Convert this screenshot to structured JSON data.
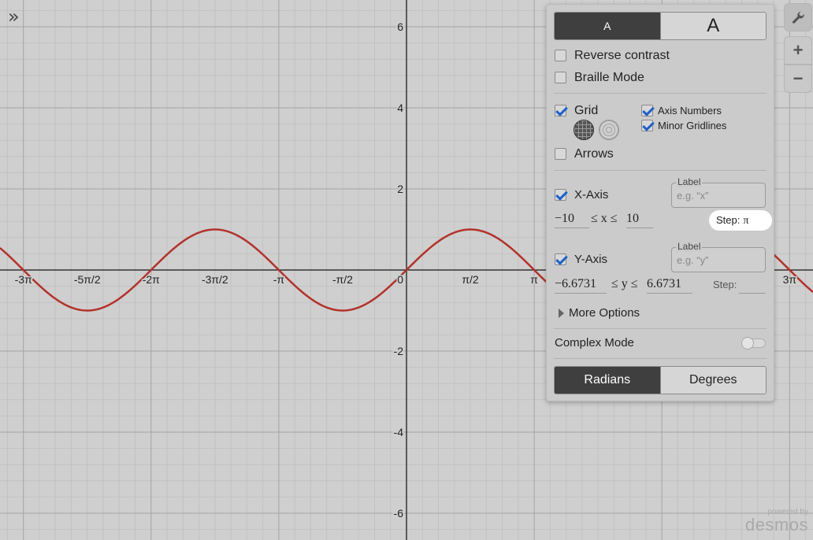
{
  "graph": {
    "x_ticks": [
      "-3π",
      "-5π/2",
      "-2π",
      "-3π/2",
      "-π",
      "-π/2",
      "π/2",
      "π",
      "3π"
    ],
    "y_ticks": [
      "6",
      "4",
      "2",
      "-2",
      "-4",
      "-6"
    ],
    "origin_label": "0",
    "curve_color": "#b3322b",
    "curve": "sin(x)"
  },
  "toolbar": {
    "expand_icon": "double-chevron-right-icon",
    "settings_icon": "wrench-icon",
    "zoom_in_label": "+",
    "zoom_out_label": "−"
  },
  "watermark": {
    "line1": "powered by",
    "line2": "desmos"
  },
  "settings": {
    "text_size": {
      "small": "A",
      "large": "A"
    },
    "reverse_contrast": {
      "label": "Reverse contrast",
      "checked": false
    },
    "braille_mode": {
      "label": "Braille Mode",
      "checked": false
    },
    "grid": {
      "label": "Grid",
      "checked": true
    },
    "axis_numbers": {
      "label": "Axis Numbers",
      "checked": true
    },
    "minor_gridlines": {
      "label": "Minor Gridlines",
      "checked": true
    },
    "arrows": {
      "label": "Arrows",
      "checked": false
    },
    "x_axis": {
      "label": "X-Axis",
      "checked": true,
      "label_caption": "Label",
      "label_placeholder": "e.g. “x”",
      "min": "−10",
      "max": "10",
      "relation": "≤ x ≤",
      "step_label": "Step:",
      "step_value": "π"
    },
    "y_axis": {
      "label": "Y-Axis",
      "checked": true,
      "label_caption": "Label",
      "label_placeholder": "e.g. “y”",
      "min": "−6.6731",
      "max": "6.6731",
      "relation": "≤ y ≤",
      "step_label": "Step:",
      "step_value": ""
    },
    "more_options": "More Options",
    "complex_mode": {
      "label": "Complex Mode",
      "on": false
    },
    "angle_mode": {
      "radians": "Radians",
      "degrees": "Degrees",
      "selected": "Radians"
    }
  }
}
